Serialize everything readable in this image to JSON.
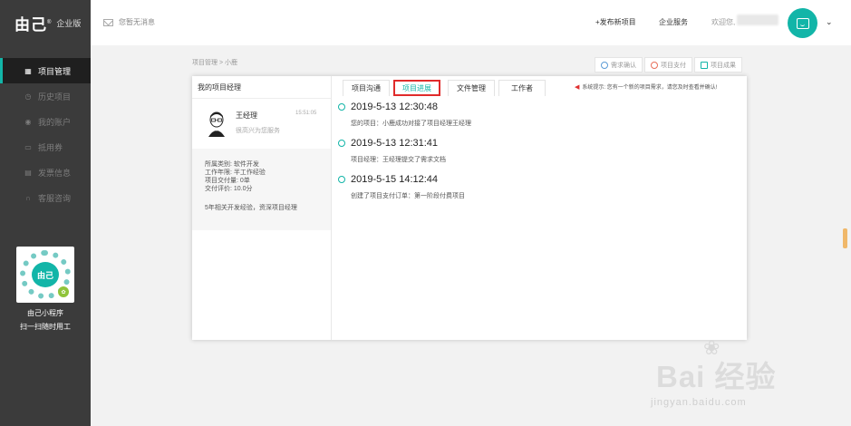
{
  "brand": {
    "logo": "由己",
    "edition": "企业版"
  },
  "sidebar": {
    "items": [
      {
        "label": "项目管理",
        "icon": "grid-icon",
        "active": true
      },
      {
        "label": "历史项目",
        "icon": "clock-icon",
        "active": false
      },
      {
        "label": "我的账户",
        "icon": "user-icon",
        "active": false
      },
      {
        "label": "抵用券",
        "icon": "ticket-icon",
        "active": false
      },
      {
        "label": "发票信息",
        "icon": "invoice-icon",
        "active": false
      },
      {
        "label": "客服咨询",
        "icon": "headset-icon",
        "active": false
      }
    ],
    "qr": {
      "logo": "由己",
      "title": "由己小程序",
      "subtitle": "扫一扫随时用工"
    }
  },
  "topbar": {
    "message": "您暂无消息",
    "post_project": "+发布新项目",
    "enterprise_service": "企业服务",
    "welcome": "欢迎您,"
  },
  "breadcrumb": "项目管理 > 小鹿",
  "actions": [
    {
      "label": "需求确认",
      "icon": "check-icon",
      "color": "#5b9bd5"
    },
    {
      "label": "项目支付",
      "icon": "pay-icon",
      "color": "#e86f5a"
    },
    {
      "label": "项目成果",
      "icon": "result-icon",
      "color": "#12b5a8"
    }
  ],
  "panel": {
    "left_title": "我的项目经理",
    "manager": {
      "name": "王经理",
      "time": "15:51:05",
      "serve": "很高兴为您服务",
      "info": [
        "所属类别: 软件开发",
        "工作年限: 半工作经验",
        "项目交付量: 0单",
        "交付评价: 10.0分"
      ],
      "desc": "5年相关开发经验，资深项目经理"
    },
    "tabs": [
      "项目沟通",
      "项目进展",
      "文件管理",
      "工作者"
    ],
    "active_tab": "项目进展",
    "notice": "系统提示: 您有一个新的项目需求，请您及时查看并确认!",
    "timeline": [
      {
        "date": "2019-5-13 12:30:48",
        "text": "您的项目：小鹿成功对接了项目经理王经理"
      },
      {
        "date": "2019-5-13 12:31:41",
        "text": "项目经理：王经理提交了需求文档"
      },
      {
        "date": "2019-5-15 14:12:44",
        "text": "创建了项目支付订单：第一阶段付费项目"
      }
    ]
  },
  "watermark": {
    "text": "Bai  经验",
    "url": "jingyan.baidu.com"
  },
  "colors": {
    "accent": "#12b5a8",
    "sidebar_bg": "#3b3b3b",
    "tab_highlight": "#e02b2b"
  }
}
